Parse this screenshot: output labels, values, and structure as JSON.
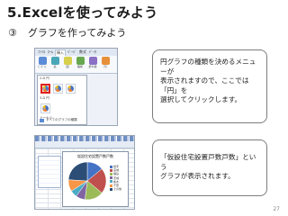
{
  "slide": {
    "title": "5.Excelを使ってみよう",
    "subtitle_number": "③",
    "subtitle_text": "グラフを作ってみよう",
    "page_number": "27"
  },
  "callouts": [
    {
      "text": "円グラフの種類を決めるメニューが\n表示されますので、ここでは「円」を\n選択してクリックします。"
    },
    {
      "text": "「仮設住宅設置戸数戸数」という\nグラフが表示されます。"
    }
  ],
  "screenshot1": {
    "ribbon_tabs": [
      "ﾌｧｲﾙ",
      "ﾎｰﾑ",
      "挿入",
      "ﾍﾟｰｼﾞ",
      "数式",
      "ﾃﾞｰﾀ"
    ],
    "active_tab": "挿入",
    "ribbon_buttons": [
      "ﾋﾟﾎﾞｯﾄ",
      "表",
      "図",
      "縦棒",
      "折れ線",
      "円"
    ],
    "dropdown_section_2d": "2-D 円",
    "dropdown_section_3d": "3-D 円",
    "dropdown_section_donut": "ドーナツ",
    "dropdown_all_types": "すべてのグラフの種類"
  },
  "screenshot2": {
    "chart_title": "仮設住宅設置戸数戸数",
    "legend": [
      "岩手",
      "宮城",
      "福島",
      "茨城",
      "栃木",
      "千葉",
      "その他"
    ],
    "colors": [
      "#4472c4",
      "#c0504d",
      "#9bbb59",
      "#8064a2",
      "#4bacc6",
      "#f79646",
      "#2c4d75"
    ]
  },
  "chart_data": {
    "type": "pie",
    "title": "仮設住宅設置戸数戸数",
    "categories": [
      "岩手",
      "宮城",
      "福島",
      "茨城",
      "栃木",
      "千葉",
      "その他"
    ],
    "values": [
      14,
      22,
      16,
      8,
      6,
      10,
      24
    ]
  }
}
